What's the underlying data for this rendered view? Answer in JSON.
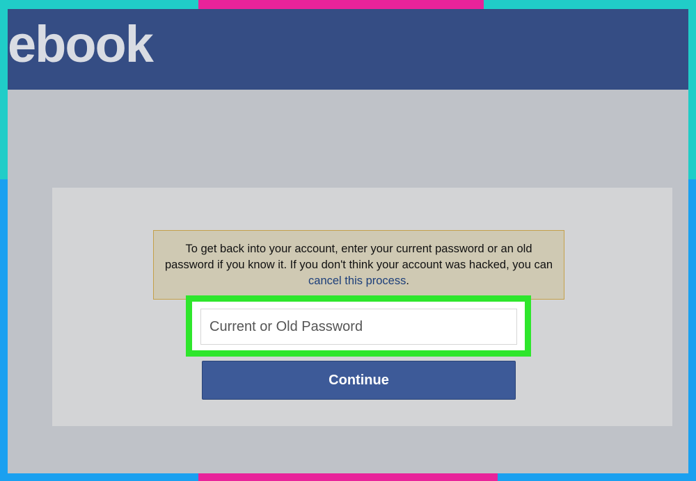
{
  "header": {
    "logo_text": "ebook"
  },
  "recovery": {
    "notice_text": "To get back into your account, enter your current password or an old password if you know it. If you don't think your account was hacked, you can ",
    "cancel_link": "cancel this process",
    "notice_end": "."
  },
  "password_field": {
    "placeholder": "Current or Old Password",
    "value": ""
  },
  "continue_button": {
    "label": "Continue"
  },
  "colors": {
    "header_bg": "#354d84",
    "highlight": "#2ee62c",
    "button_bg": "#3d5a98",
    "notice_bg": "#cfc9b3",
    "frame_teal": "#20cdc8",
    "frame_pink": "#e8239a",
    "frame_blue": "#1aa0f0"
  }
}
